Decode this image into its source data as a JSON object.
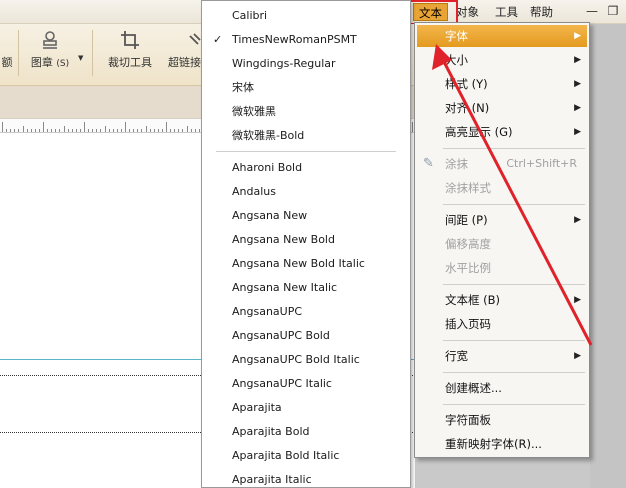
{
  "menubar": {
    "items": [
      {
        "label": "文本",
        "active": true
      },
      {
        "label": "对象"
      },
      {
        "label": "工具"
      },
      {
        "label": "帮助"
      }
    ],
    "minimize_glyph": "—",
    "restore_glyph": "❐"
  },
  "toolbar": {
    "partial_left": "额",
    "stamp_label": "图章",
    "stamp_shortcut": "(S)",
    "crop_label": "裁切工具",
    "link_label": "超链接"
  },
  "font_list": {
    "top_fonts": [
      {
        "name": "Calibri"
      },
      {
        "name": "TimesNewRomanPSMT",
        "checked": true
      },
      {
        "name": "Wingdings-Regular"
      },
      {
        "name": "宋体"
      },
      {
        "name": "微软雅黑"
      },
      {
        "name": "微软雅黑-Bold"
      }
    ],
    "fonts": [
      "Aharoni Bold",
      "Andalus",
      "Angsana New",
      "Angsana New Bold",
      "Angsana New Bold Italic",
      "Angsana New Italic",
      "AngsanaUPC",
      "AngsanaUPC Bold",
      "AngsanaUPC Bold Italic",
      "AngsanaUPC Italic",
      "Aparajita",
      "Aparajita Bold",
      "Aparajita Bold Italic",
      "Aparajita Italic"
    ],
    "check_glyph": "✓"
  },
  "text_menu": {
    "font": "字体",
    "size": "大小",
    "style": "样式 (Y)",
    "align": "对齐 (N)",
    "highlight": "高亮显示 (G)",
    "smear": "涂抹",
    "smear_shortcut": "Ctrl+Shift+R",
    "smear_style": "涂抹样式",
    "spacing": "间距 (P)",
    "offset_height": "偏移高度",
    "horizontal_scale": "水平比例",
    "text_box": "文本框 (B)",
    "insert_page_number": "插入页码",
    "line_width": "行宽",
    "create_summary": "创建概述...",
    "character_panel": "字符面板",
    "remap_fonts": "重新映射字体(R)...",
    "submenu_arrow": "▶"
  },
  "colors": {
    "accent": "#e8a434",
    "annotation_red": "#e0222a"
  }
}
